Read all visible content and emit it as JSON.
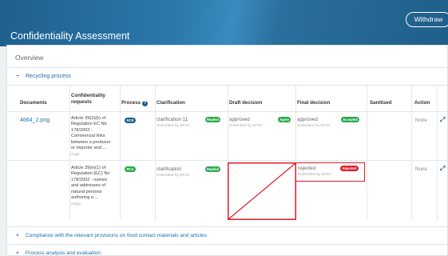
{
  "header": {
    "title": "Confidentiality Assessment",
    "withdraw_label": "Withdraw"
  },
  "overview": {
    "label": "Overview"
  },
  "sections": {
    "recycling": {
      "sign": "−",
      "label": "Recycling process"
    },
    "compliance": {
      "sign": "+",
      "label": "Compliance with the relevant provisions on food contact materials and articles"
    },
    "process_analysis": {
      "sign": "+",
      "label": "Process analysis and evaluation"
    }
  },
  "table": {
    "headers": {
      "documents": "Documents",
      "confidentiality_requests": "Confidentiality requests",
      "process": "Process",
      "clarification": "Clarification",
      "draft_decision": "Draft decision",
      "final_decision": "Final decision",
      "sanitised": "Sanitised",
      "action": "Action"
    },
    "rows": [
      {
        "document": "4664_2.png",
        "request": "Article 39(2)(b) of Regulation EC No 178/2002 - Commercial links between a producer or importer and ...",
        "request_sub": "engp",
        "process_badge": "RCR",
        "clarification": "clarification 11",
        "clarification_badge": "Replied",
        "clarification_sub": "Submitted by EFSA",
        "draft": "approved",
        "draft_badge": "Agree",
        "draft_sub": "Submitted by EFSA",
        "final": "approved",
        "final_badge": "Accepted",
        "final_sub": "Submitted by EFSA",
        "action": "None"
      },
      {
        "document": "",
        "request": "Article 39(e)(1) of Regulation (EC) No 178/2002 - names and addresses of natural persons authoring a ...",
        "request_sub": "engrg",
        "process_badge": "RCA",
        "clarification": "clarification",
        "clarification_badge": "Replied",
        "clarification_sub": "Submitted by EFSA",
        "draft": "",
        "final": "rejected",
        "final_badge": "Rejected",
        "final_sub": "Submitted by EFSA",
        "action": "None"
      }
    ]
  },
  "colors": {
    "link": "#1e6ea8",
    "badge_green": "#27a84a",
    "badge_blue": "#1e5f8d",
    "badge_red": "#e11b2a",
    "highlight": "#e11b2a"
  },
  "icons": {
    "help": "question-circle-icon",
    "expand": "diagonal-arrows-icon"
  }
}
